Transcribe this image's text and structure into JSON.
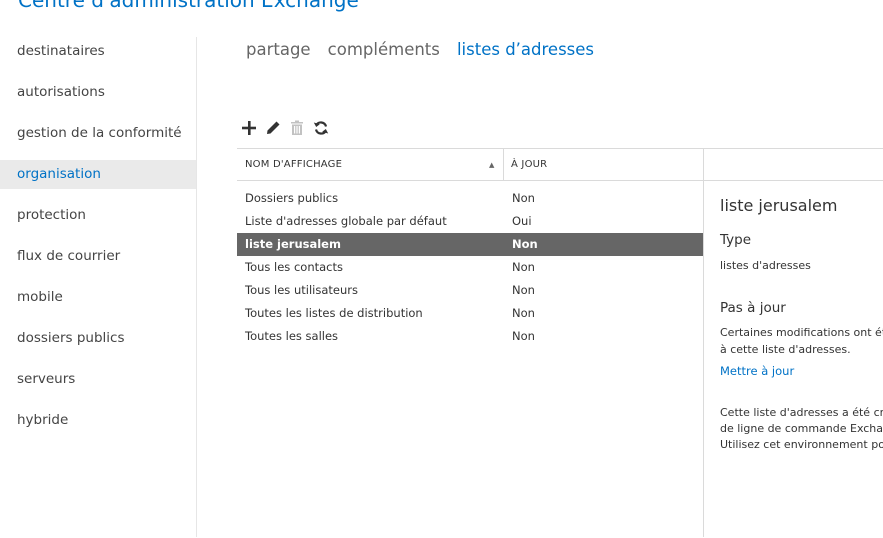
{
  "app": {
    "title": "Centre d'administration Exchange"
  },
  "sidebar": {
    "items": [
      {
        "label": "destinataires"
      },
      {
        "label": "autorisations"
      },
      {
        "label": "gestion de la conformité"
      },
      {
        "label": "organisation"
      },
      {
        "label": "protection"
      },
      {
        "label": "flux de courrier"
      },
      {
        "label": "mobile"
      },
      {
        "label": "dossiers publics"
      },
      {
        "label": "serveurs"
      },
      {
        "label": "hybride"
      }
    ],
    "active": "organisation"
  },
  "tabs": [
    {
      "label": "partage"
    },
    {
      "label": "compléments"
    },
    {
      "label": "listes d’adresses"
    }
  ],
  "toolbar": {
    "icons": [
      "add-icon",
      "edit-icon",
      "delete-icon",
      "refresh-icon"
    ]
  },
  "table": {
    "columns": [
      "NOM D'AFFICHAGE",
      "À JOUR"
    ],
    "rows": [
      {
        "name": "Dossiers publics",
        "status": "Non"
      },
      {
        "name": "Liste d'adresses globale par défaut",
        "status": "Oui"
      },
      {
        "name": "liste jerusalem",
        "status": "Non"
      },
      {
        "name": "Tous les contacts",
        "status": "Non"
      },
      {
        "name": "Tous les utilisateurs",
        "status": "Non"
      },
      {
        "name": "Toutes les listes de distribution",
        "status": "Non"
      },
      {
        "name": "Toutes les salles",
        "status": "Non"
      }
    ],
    "selected": "liste jerusalem"
  },
  "details": {
    "title": "liste jerusalem",
    "type_label": "Type",
    "type_value": "listes d'adresses",
    "status_label": "Pas à jour",
    "status_text_1": "Certaines modifications ont été",
    "status_text_2": "à cette liste d'adresses.",
    "update_link": "Mettre à jour",
    "note_1": "Cette liste d'adresses a été créée",
    "note_2": "de ligne de commande Exchange",
    "note_3": "Utilisez cet environnement pour"
  },
  "colors": {
    "accent": "#0072c6",
    "selected_row": "#666666",
    "active_nav_bg": "#eaeaea"
  }
}
